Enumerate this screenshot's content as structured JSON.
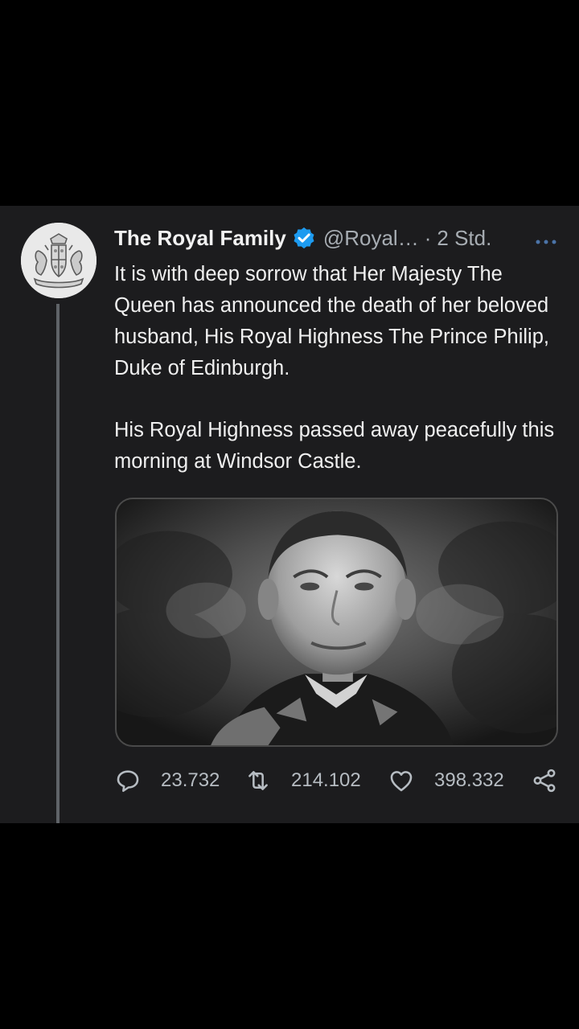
{
  "tweet": {
    "author_name": "The Royal Family",
    "handle": "@Royal…",
    "separator": "·",
    "time": "2 Std.",
    "paragraphs": [
      "It is with deep sorrow that Her Majesty The Queen has announced the death of her beloved husband, His Royal Highness The Prince Philip, Duke of Edinburgh.",
      "His Royal Highness passed away peacefully this morning at Windsor Castle."
    ]
  },
  "actions": {
    "replies": "23.732",
    "retweets": "214.102",
    "likes": "398.332"
  },
  "icons": {
    "verified": "verified-badge-icon",
    "more": "more-options-icon",
    "reply": "reply-icon",
    "retweet": "retweet-icon",
    "like": "heart-icon",
    "share": "share-icon",
    "avatar": "royal-coat-of-arms-icon"
  },
  "colors": {
    "background": "#000000",
    "card": "#1c1c1e",
    "verified": "#1d9bf0",
    "text": "#f0f0f0",
    "secondary_text": "#a7adb3"
  }
}
